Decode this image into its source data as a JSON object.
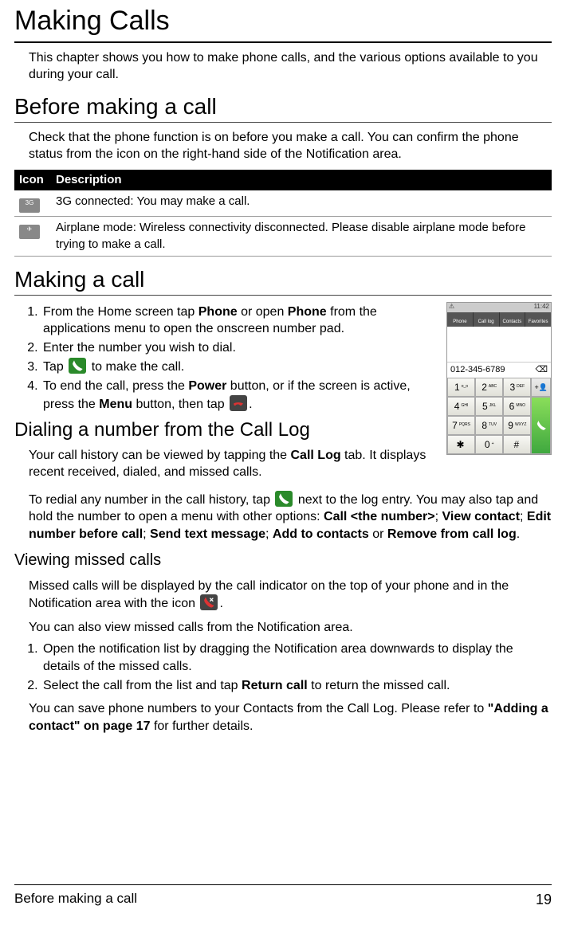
{
  "chapter_title": "Making Calls",
  "intro": "This chapter shows you how to make phone calls, and the various options available to you during your call.",
  "sections": {
    "before": {
      "title": "Before making a call",
      "body": "Check that the phone function is on before you make a call. You can confirm the phone status from the icon on the right-hand side of the Notification area.",
      "table": {
        "h_icon": "Icon",
        "h_desc": "Description",
        "r1_icon": "3G",
        "r1_desc": "3G connected: You may make a call.",
        "r2_icon": "✈",
        "r2_desc": "Airplane mode: Wireless connectivity disconnected. Please disable airplane mode before trying to make a call."
      }
    },
    "making": {
      "title": "Making a call",
      "step1_a": "From the Home screen tap ",
      "step1_b": "Phone",
      "step1_c": " or open ",
      "step1_d": "Phone",
      "step1_e": " from the applications menu to open the onscreen number pad.",
      "step2": "Enter the number you wish to dial.",
      "step3_a": "Tap ",
      "step3_b": " to make the call.",
      "step4_a": "To end the call, press the ",
      "step4_b": "Power",
      "step4_c": " button, or if the screen is active, press the ",
      "step4_d": "Menu",
      "step4_e": " button, then tap ",
      "step4_f": "."
    },
    "calllog": {
      "title": "Dialing a number from the Call Log",
      "p1_a": "Your call history can be viewed by tapping the ",
      "p1_b": "Call Log",
      "p1_c": " tab. It displays recent received, dialed, and missed calls.",
      "p2_a": "To redial any number in the call history, tap ",
      "p2_b": " next to the log entry. You may also tap and hold the number to open a menu with other options: ",
      "p2_c": "Call <the number>",
      "p2_d": "; ",
      "p2_e": "View contact",
      "p2_f": "; ",
      "p2_g": "Edit number before call",
      "p2_h": "; ",
      "p2_i": "Send text message",
      "p2_j": "; ",
      "p2_k": "Add to contacts",
      "p2_l": " or ",
      "p2_m": "Remove from call log",
      "p2_n": "."
    },
    "missed": {
      "title": "Viewing missed calls",
      "p1_a": "Missed calls will be displayed by the call indicator on the top of your phone and in the Notification area with the icon ",
      "p1_b": ".",
      "p2": "You can also view missed calls from the Notification area.",
      "step1": "Open the notification list by dragging the Notification area downwards to display the details of the missed calls.",
      "step2_a": "Select the call from the list and tap ",
      "step2_b": "Return call",
      "step2_c": " to return the missed call.",
      "p3_a": "You can save phone numbers to your Contacts from the Call Log. Please refer to ",
      "p3_b": "\"Adding a contact\" on page 17",
      "p3_c": " for further details."
    }
  },
  "phone": {
    "status_left": "⚠",
    "status_right": "11:42",
    "tabs": [
      "Phone",
      "Call log",
      "Contacts",
      "Favorites"
    ],
    "number": "012-345-6789",
    "keys": {
      "k1": "1",
      "k1s": "o_o",
      "k2": "2",
      "k2s": "ABC",
      "k3": "3",
      "k3s": "DEF",
      "k4": "4",
      "k4s": "GHI",
      "k5": "5",
      "k5s": "JKL",
      "k6": "6",
      "k6s": "MNO",
      "k7": "7",
      "k7s": "PQRS",
      "k8": "8",
      "k8s": "TUV",
      "k9": "9",
      "k9s": "WXYZ",
      "kstar": "✱",
      "k0": "0",
      "k0s": "+",
      "khash": "#",
      "addcontact": "+👤",
      "backspace": "⌫"
    }
  },
  "footer": {
    "section": "Before making a call",
    "page": "19"
  }
}
